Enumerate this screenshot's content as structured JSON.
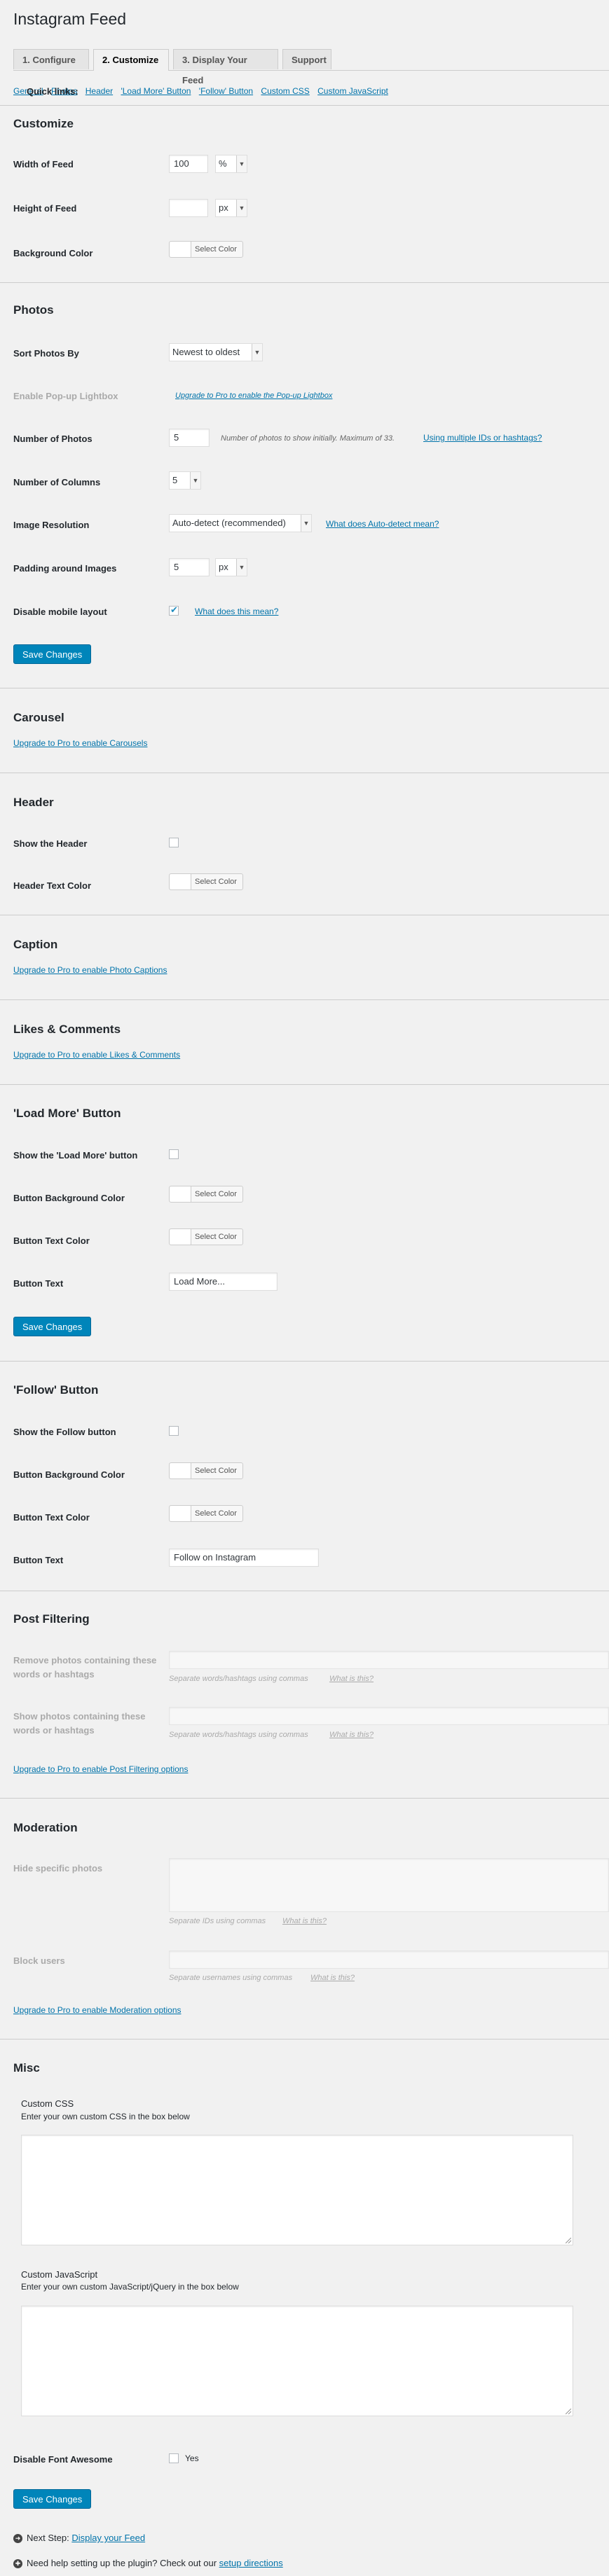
{
  "page_title": "Instagram Feed",
  "tabs": [
    {
      "label": "1. Configure",
      "active": false
    },
    {
      "label": "2. Customize",
      "active": true
    },
    {
      "label": "3. Display Your Feed",
      "active": false
    },
    {
      "label": "Support",
      "active": false
    }
  ],
  "quick_links": {
    "label": "Quick links:",
    "items": [
      "General",
      "Photos",
      "Header",
      "'Load More' Button",
      "'Follow' Button",
      "Custom CSS",
      "Custom JavaScript"
    ]
  },
  "customize": {
    "title": "Customize",
    "width_label": "Width of Feed",
    "width_value": "100",
    "width_unit": "%",
    "height_label": "Height of Feed",
    "height_value": "",
    "height_unit": "px",
    "bg_label": "Background Color",
    "bg_button": "Select Color"
  },
  "photos": {
    "title": "Photos",
    "sort_label": "Sort Photos By",
    "sort_value": "Newest to oldest",
    "lightbox_label": "Enable Pop-up Lightbox",
    "lightbox_link": "Upgrade to Pro to enable the Pop-up Lightbox",
    "num_label": "Number of Photos",
    "num_value": "5",
    "num_note": "Number of photos to show initially. Maximum of 33.",
    "num_link": "Using multiple IDs or hashtags?",
    "cols_label": "Number of Columns",
    "cols_value": "5",
    "res_label": "Image Resolution",
    "res_value": "Auto-detect (recommended)",
    "res_link": "What does Auto-detect mean?",
    "pad_label": "Padding around Images",
    "pad_value": "5",
    "pad_unit": "px",
    "mobile_label": "Disable mobile layout",
    "mobile_checked": true,
    "mobile_link": "What does this mean?",
    "save": "Save Changes"
  },
  "carousel": {
    "title": "Carousel",
    "link": "Upgrade to Pro to enable Carousels"
  },
  "header": {
    "title": "Header",
    "show_label": "Show the Header",
    "show_checked": false,
    "text_color_label": "Header Text Color",
    "text_color_button": "Select Color"
  },
  "caption": {
    "title": "Caption",
    "link": "Upgrade to Pro to enable Photo Captions"
  },
  "likes": {
    "title": "Likes & Comments",
    "link": "Upgrade to Pro to enable Likes & Comments"
  },
  "load_more": {
    "title": "'Load More' Button",
    "show_label": "Show the 'Load More' button",
    "show_checked": false,
    "bg_label": "Button Background Color",
    "bg_button": "Select Color",
    "text_color_label": "Button Text Color",
    "text_color_button": "Select Color",
    "text_label": "Button Text",
    "text_value": "Load More...",
    "save": "Save Changes"
  },
  "follow": {
    "title": "'Follow' Button",
    "show_label": "Show the Follow button",
    "show_checked": false,
    "bg_label": "Button Background Color",
    "bg_button": "Select Color",
    "text_color_label": "Button Text Color",
    "text_color_button": "Select Color",
    "text_label": "Button Text",
    "text_value": "Follow on Instagram"
  },
  "post_filtering": {
    "title": "Post Filtering",
    "remove_label": "Remove photos containing these words or hashtags",
    "remove_note": "Separate words/hashtags using commas",
    "remove_link": "What is this?",
    "show_label": "Show photos containing these words or hashtags",
    "show_note": "Separate words/hashtags using commas",
    "show_link": "What is this?",
    "upgrade_link": "Upgrade to Pro to enable Post Filtering options"
  },
  "moderation": {
    "title": "Moderation",
    "hide_label": "Hide specific photos",
    "hide_note": "Separate IDs using commas",
    "hide_link": "What is this?",
    "block_label": "Block users",
    "block_note": "Separate usernames using commas",
    "block_link": "What is this?",
    "upgrade_link": "Upgrade to Pro to enable Moderation options"
  },
  "misc": {
    "title": "Misc",
    "css_title": "Custom CSS",
    "css_desc": "Enter your own custom CSS in the box below",
    "js_title": "Custom JavaScript",
    "js_desc": "Enter your own custom JavaScript/jQuery in the box below",
    "fa_label": "Disable Font Awesome",
    "fa_checked": false,
    "fa_yes": "Yes",
    "save": "Save Changes"
  },
  "footer": {
    "next_prefix": "Next Step:",
    "next_link": "Display your Feed",
    "help_prefix": "Need help setting up the plugin? Check out our",
    "help_link": "setup directions"
  },
  "colors": {
    "accent": "#0085ba",
    "link": "#0073aa",
    "background": "#f1f1f1"
  }
}
